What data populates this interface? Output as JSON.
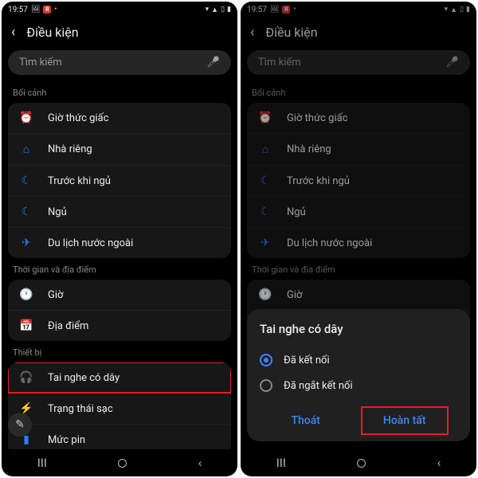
{
  "status": {
    "time": "19:57",
    "rec": "R"
  },
  "header": {
    "title": "Điều kiện"
  },
  "search": {
    "placeholder": "Tìm kiếm"
  },
  "sections": {
    "context_label": "Bối cảnh",
    "time_loc_label": "Thời gian và địa điểm",
    "device_label": "Thiết bị"
  },
  "rows": {
    "wake": "Giờ thức giấc",
    "home": "Nhà riêng",
    "before_sleep": "Trước khi ngủ",
    "sleep": "Ngủ",
    "travel": "Du lịch nước ngoài",
    "time": "Giờ",
    "location": "Địa điểm",
    "headphone": "Tai nghe có dây",
    "charging": "Trạng thái sạc",
    "battery": "Mức pin"
  },
  "popup": {
    "title": "Tai nghe có dây",
    "connected": "Đã kết nối",
    "disconnected": "Đã ngắt kết nối",
    "exit": "Thoát",
    "done": "Hoàn tất"
  }
}
